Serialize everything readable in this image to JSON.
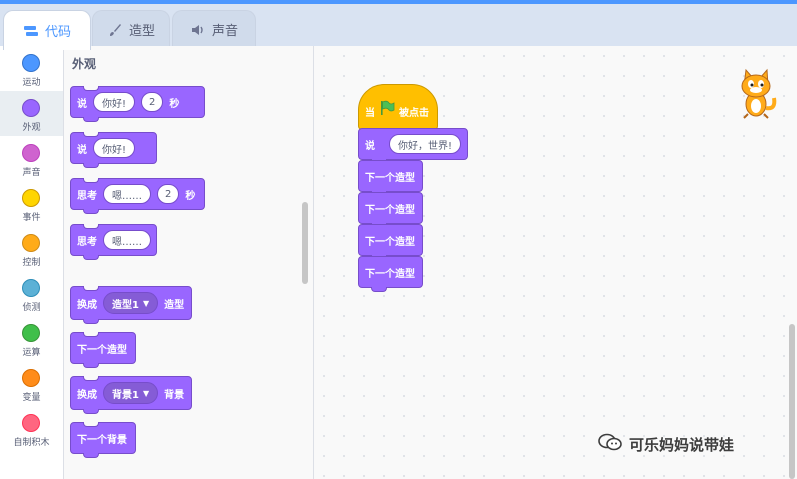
{
  "tabs": [
    {
      "label": "代码",
      "icon": "code-icon",
      "active": true
    },
    {
      "label": "造型",
      "icon": "brush-icon",
      "active": false
    },
    {
      "label": "声音",
      "icon": "speaker-icon",
      "active": false
    }
  ],
  "categories": [
    {
      "label": "运动",
      "color": "#4c97ff"
    },
    {
      "label": "外观",
      "color": "#9966ff",
      "selected": true
    },
    {
      "label": "声音",
      "color": "#cf63cf"
    },
    {
      "label": "事件",
      "color": "#ffd500"
    },
    {
      "label": "控制",
      "color": "#ffab19"
    },
    {
      "label": "侦测",
      "color": "#5cb1d6"
    },
    {
      "label": "运算",
      "color": "#40bf4a"
    },
    {
      "label": "变量",
      "color": "#ff8c1a"
    },
    {
      "label": "自制积木",
      "color": "#ff6680"
    }
  ],
  "palette": {
    "heading": "外观",
    "say_secs": {
      "label": "说",
      "text": "你好!",
      "secs": "2",
      "unit": "秒"
    },
    "say": {
      "label": "说",
      "text": "你好!"
    },
    "think_secs": {
      "label": "思考",
      "text": "嗯……",
      "secs": "2",
      "unit": "秒"
    },
    "think": {
      "label": "思考",
      "text": "嗯……"
    },
    "switch_costume": {
      "label": "换成",
      "value": "造型1",
      "suffix": "造型"
    },
    "next_costume": {
      "label": "下一个造型"
    },
    "switch_backdrop": {
      "label": "换成",
      "value": "背景1",
      "suffix": "背景"
    },
    "next_backdrop": {
      "label": "下一个背景"
    }
  },
  "workspace": {
    "hat": {
      "prefix": "当",
      "suffix": "被点击"
    },
    "say": {
      "label": "说",
      "text": "你好，世界!"
    },
    "next_costume": [
      "下一个造型",
      "下一个造型",
      "下一个造型",
      "下一个造型"
    ]
  },
  "watermark": "可乐妈妈说带娃",
  "colors": {
    "looks": "#9966ff",
    "events": "#ffbf00",
    "accent": "#4c97ff"
  }
}
